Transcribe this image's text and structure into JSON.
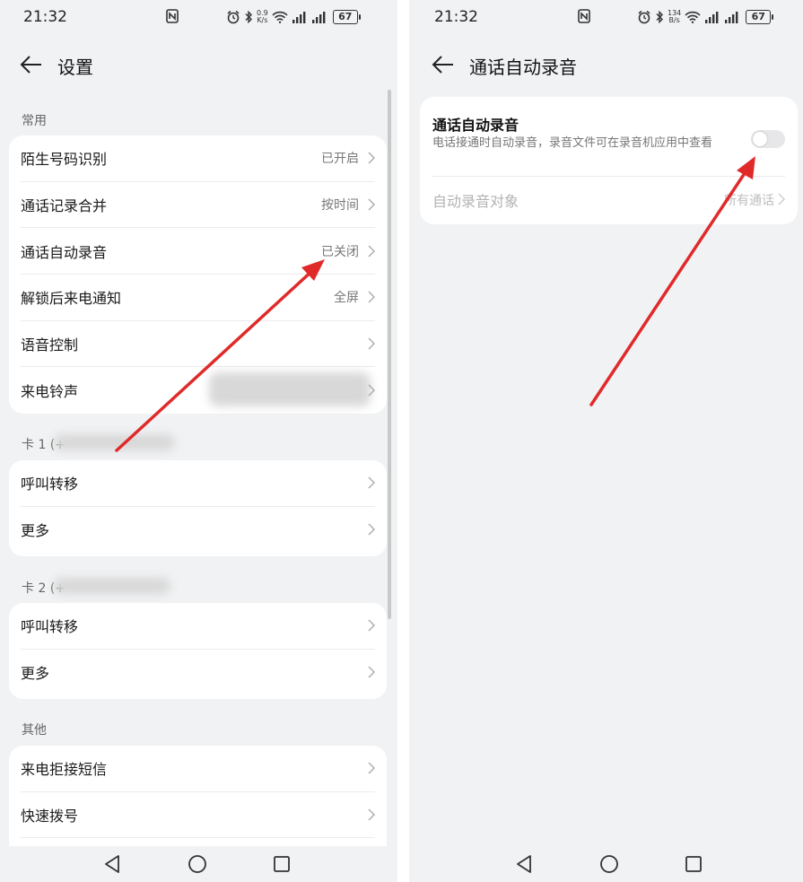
{
  "left_screen": {
    "status": {
      "time": "21:32",
      "speed_top": "0.9",
      "speed_bottom": "K/s",
      "battery": "67"
    },
    "title": "设置",
    "sections": [
      {
        "label": "常用",
        "items": [
          {
            "label": "陌生号码识别",
            "value": "已开启"
          },
          {
            "label": "通话记录合并",
            "value": "按时间"
          },
          {
            "label": "通话自动录音",
            "value": "已关闭"
          },
          {
            "label": "解锁后来电通知",
            "value": "全屏"
          },
          {
            "label": "语音控制",
            "value": ""
          },
          {
            "label": "来电铃声",
            "value": ""
          }
        ]
      },
      {
        "label": "卡 1 (+",
        "items": [
          {
            "label": "呼叫转移",
            "value": ""
          },
          {
            "label": "更多",
            "value": ""
          }
        ]
      },
      {
        "label": "卡 2 (+",
        "items": [
          {
            "label": "呼叫转移",
            "value": ""
          },
          {
            "label": "更多",
            "value": ""
          }
        ]
      },
      {
        "label": "其他",
        "items": [
          {
            "label": "来电拒接短信",
            "value": ""
          },
          {
            "label": "快速拨号",
            "value": ""
          }
        ]
      }
    ]
  },
  "right_screen": {
    "status": {
      "time": "21:32",
      "speed_top": "134",
      "speed_bottom": "B/s",
      "battery": "67"
    },
    "title": "通话自动录音",
    "toggle_item": {
      "title": "通话自动录音",
      "description": "电话接通时自动录音，录音文件可在录音机应用中查看",
      "enabled": false
    },
    "target_item": {
      "label": "自动录音对象",
      "value": "所有通话"
    }
  },
  "colors": {
    "background": "#f1f2f4",
    "card": "#ffffff",
    "arrow": "#e02a2a",
    "secondary_text": "#777777"
  }
}
